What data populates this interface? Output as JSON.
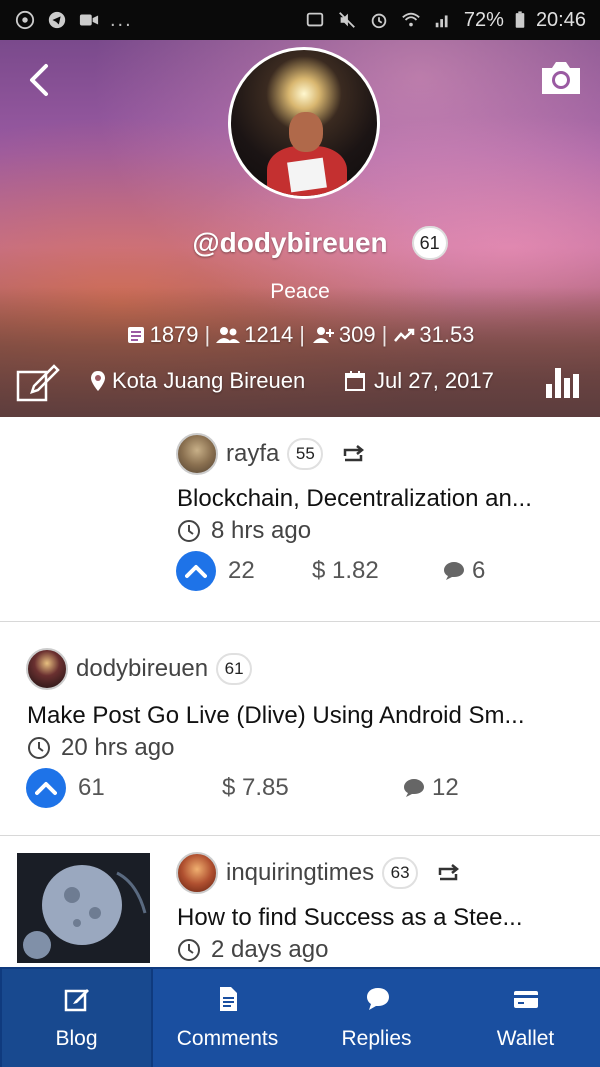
{
  "status_bar": {
    "battery": "72%",
    "time": "20:46",
    "overflow": "..."
  },
  "profile": {
    "username": "@dodybireuen",
    "reputation": "61",
    "bio": "Peace",
    "stats": {
      "posts": "1879",
      "followers": "1214",
      "following": "309",
      "power": "31.53"
    },
    "location": "Kota Juang Bireuen",
    "joined": "Jul 27, 2017"
  },
  "posts": [
    {
      "author": "rayfa",
      "reputation": "55",
      "resteemed": true,
      "title": "Blockchain, Decentralization an...",
      "time": "8 hrs ago",
      "votes": "22",
      "payout": "$ 1.82",
      "comments": "6"
    },
    {
      "author": "dodybireuen",
      "reputation": "61",
      "resteemed": false,
      "title": "Make Post Go Live (Dlive) Using Android Sm...",
      "time": "20 hrs ago",
      "votes": "61",
      "payout": "$ 7.85",
      "comments": "12"
    },
    {
      "author": "inquiringtimes",
      "reputation": "63",
      "resteemed": true,
      "title": "How to find Success as a Stee...",
      "time": "2 days ago"
    }
  ],
  "nav": {
    "items": [
      {
        "label": "Blog",
        "icon": "edit-icon",
        "active": true
      },
      {
        "label": "Comments",
        "icon": "document-icon",
        "active": false
      },
      {
        "label": "Replies",
        "icon": "chat-bubble-icon",
        "active": false
      },
      {
        "label": "Wallet",
        "icon": "wallet-icon",
        "active": false
      }
    ]
  },
  "colors": {
    "nav_bg": "#1a4fa0",
    "vote_blue": "#1e73e8",
    "header_purple": "#9a5aa2"
  }
}
